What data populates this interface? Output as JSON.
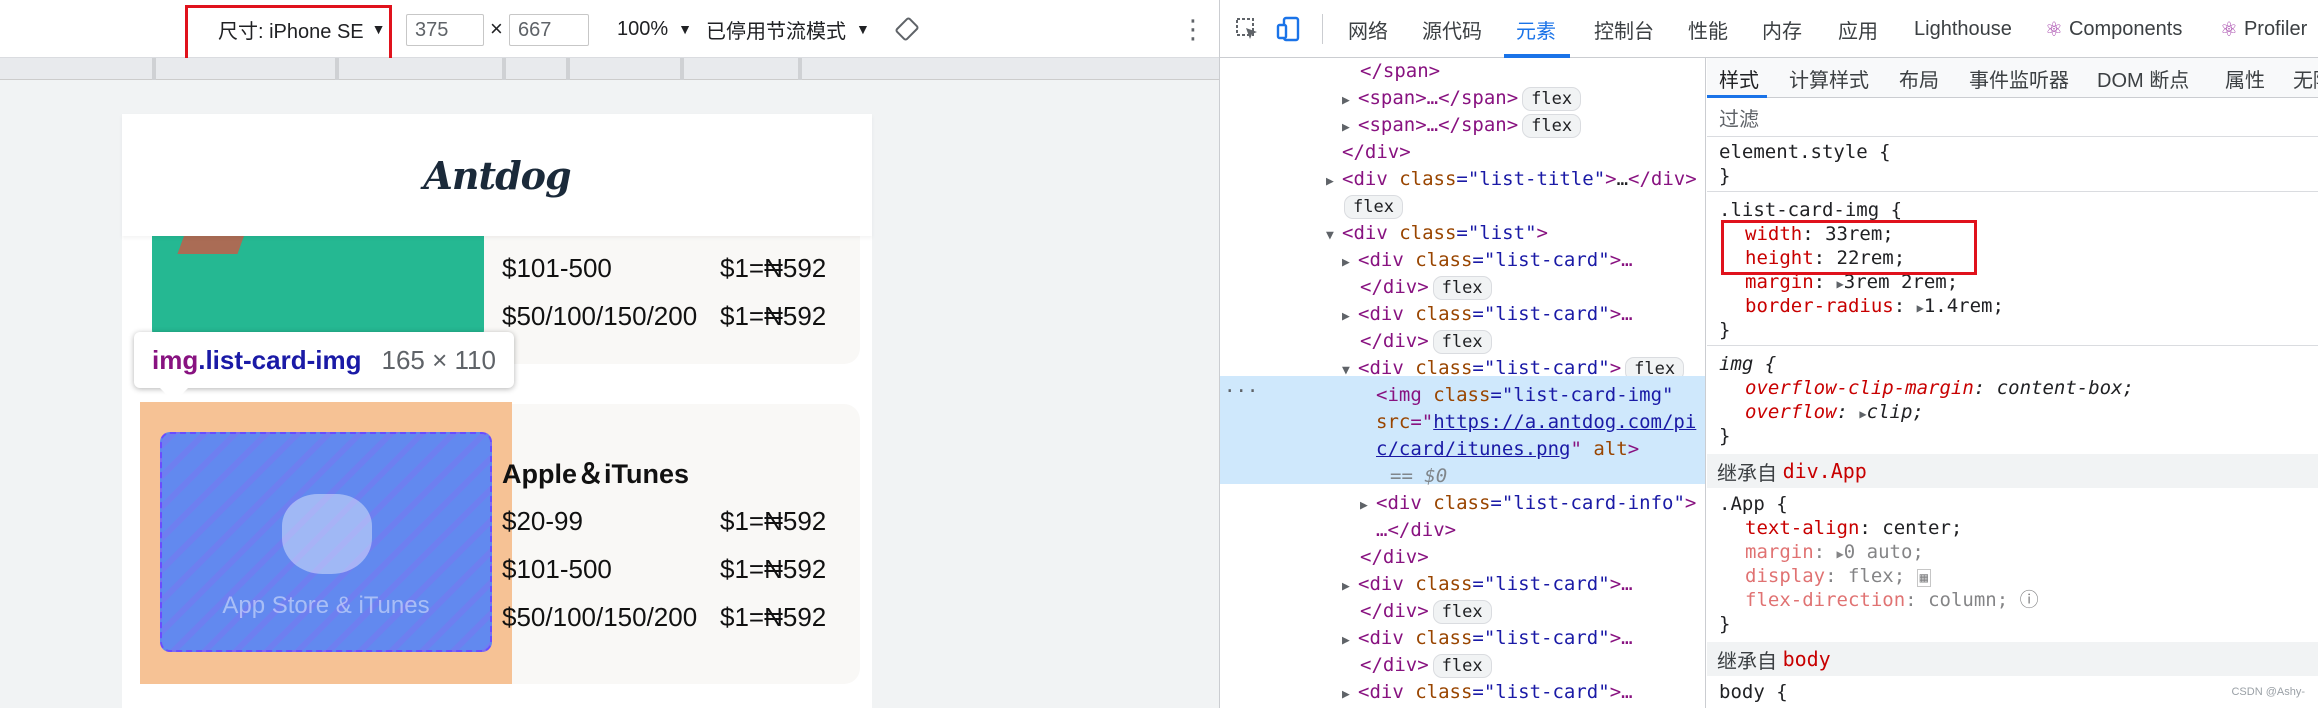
{
  "device_toolbar": {
    "dimensions_label": "尺寸: iPhone SE",
    "width": "375",
    "times": "×",
    "height": "667",
    "zoom": "100%",
    "throttle": "已停用节流模式",
    "more_icon": "more-vertical-icon",
    "rotate_icon": "rotate-icon"
  },
  "page": {
    "logo": "Antdog",
    "card1_rows": [
      {
        "range": "$101-500",
        "rate": "$1=₦592"
      },
      {
        "range": "$50/100/150/200",
        "rate": "$1=₦592"
      }
    ],
    "card2": {
      "title": "Apple＆iTunes",
      "image_text": "App Store & iTunes",
      "rows": [
        {
          "range": "$20-99",
          "rate": "$1=₦592"
        },
        {
          "range": "$101-500",
          "rate": "$1=₦592"
        },
        {
          "range": "$50/100/150/200",
          "rate": "$1=₦592"
        }
      ]
    },
    "tooltip": {
      "tag": "img",
      "cls": ".list-card-img",
      "size": "165 × 110"
    }
  },
  "devtools": {
    "tabs": [
      "网络",
      "源代码",
      "元素",
      "控制台",
      "性能",
      "内存",
      "应用",
      "Lighthouse",
      "Components",
      "Profiler"
    ],
    "active_tab": "元素",
    "dom": {
      "l1": "</span>",
      "l2": "<span>…</span>",
      "l3": "<span>…</span>",
      "l4": "</div>",
      "open": "<div ",
      "cls_attr": "class",
      "eq_q": "=\"",
      "q_close": "\">",
      "ellipsis_close": "…</div>",
      "list_title": "list-title",
      "list": "list",
      "list_card": "list-card",
      "list_card_open_tail": ">…",
      "close_div": "</div>",
      "img_open": "<img ",
      "img_cls": "list-card-img",
      "src_attr": "src",
      "src_val_1": "https://a.antdog.com/pi",
      "src_val_2": "c/card/itunes.png",
      "alt_attr": "alt",
      "eq0": "== $0",
      "list_card_info": "list-card-info",
      "info_tail": "…</div>",
      "flex": "flex",
      "dots": "···"
    },
    "styles_tabs": [
      "样式",
      "计算样式",
      "布局",
      "事件监听器",
      "DOM 断点",
      "属性",
      "无障"
    ],
    "filter": "过滤",
    "rules": {
      "element_style": "element.style {",
      "close": "}",
      "lci_sel": ".list-card-img {",
      "width_n": "width",
      "width_v": "33rem;",
      "height_n": "height",
      "height_v": "22rem;",
      "margin_n": "margin",
      "margin_v": "3rem 2rem;",
      "radius_n": "border-radius",
      "radius_v": "1.4rem;",
      "img_sel": "img {",
      "ocm_n": "overflow-clip-margin",
      "ocm_v": "content-box;",
      "of_n": "overflow",
      "of_v": "clip;",
      "inherit_label": "继承自",
      "inherit_app": "div.App",
      "app_sel": ".App {",
      "ta_n": "text-align",
      "ta_v": "center;",
      "m_n": "margin",
      "m_v": "0 auto;",
      "d_n": "display",
      "d_v": "flex;",
      "fd_n": "flex-direction",
      "fd_v": "column;",
      "inherit_body": "body",
      "body_sel": "body {",
      "colon": ":"
    },
    "watermark": "CSDN @Ashy-"
  }
}
